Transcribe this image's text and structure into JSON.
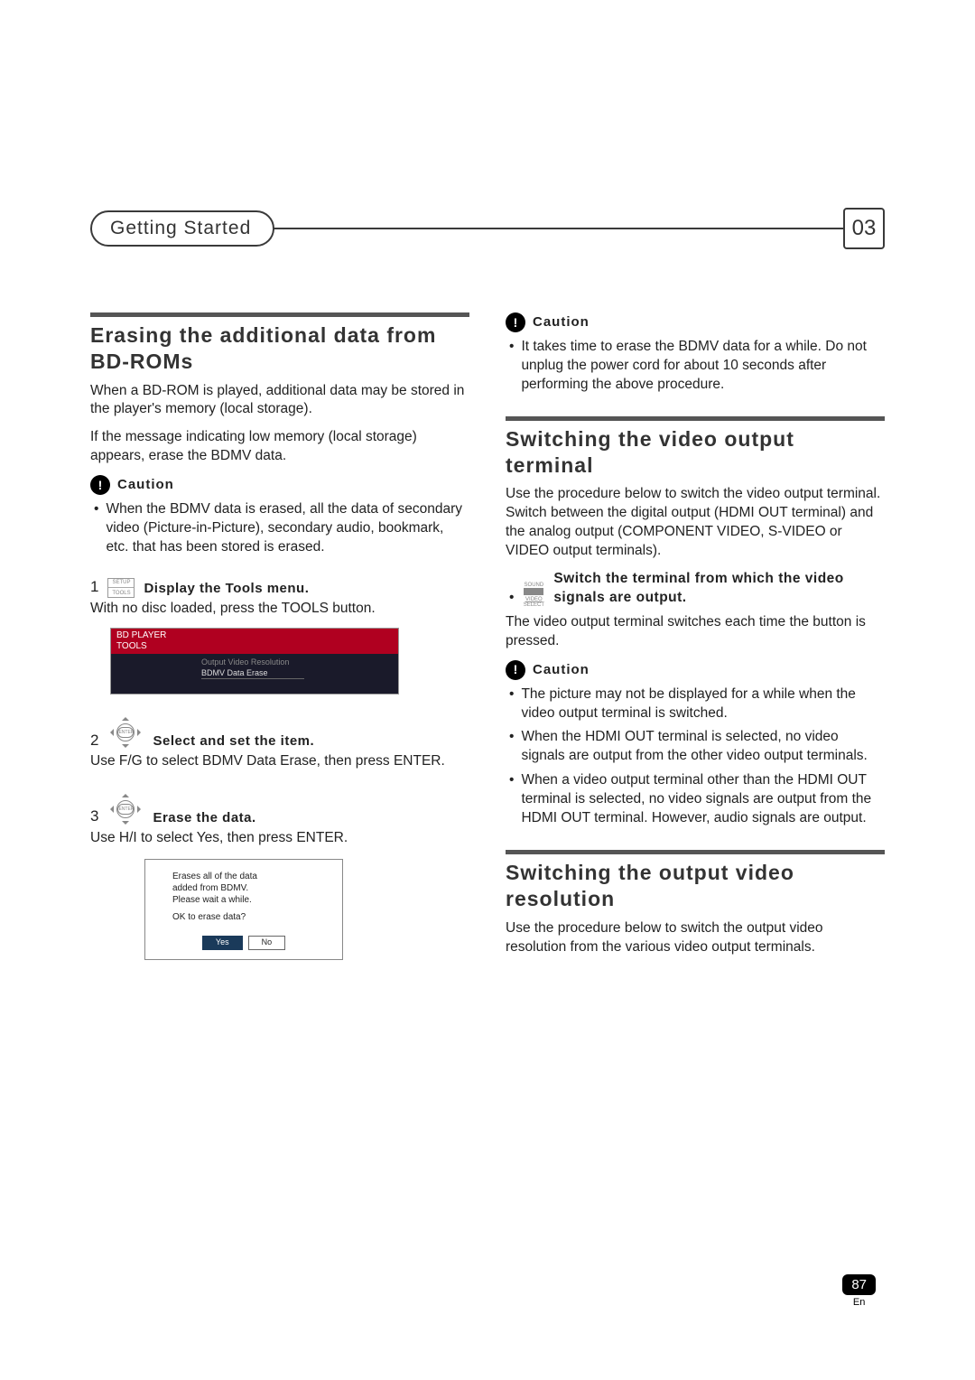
{
  "header": {
    "section_name": "Getting Started",
    "chapter": "03"
  },
  "left": {
    "title": "Erasing the additional data from BD-ROMs",
    "p1": "When a BD-ROM is played, additional data may be stored in the player's memory (local storage).",
    "p2": "If the message indicating low memory (local storage) appears, erase the BDMV data.",
    "caution_label": "Caution",
    "caution_b1": "When the BDMV data is erased, all the data of secondary video (Picture-in-Picture), secondary audio, bookmark, etc. that has been stored is erased.",
    "step1_num": "1",
    "step1_icon_top": "SETUP",
    "step1_icon_bottom": "TOOLS",
    "step1_title": "Display the Tools menu.",
    "step1_body": "With no disc loaded, press the TOOLS button.",
    "menu": {
      "line1": "BD PLAYER",
      "line2": "TOOLS",
      "item1": "Output Video Resolution",
      "item2": "BDMV Data Erase"
    },
    "step2_num": "2",
    "step2_title": "Select and set the item.",
    "step2_body": "Use F/G to select BDMV Data Erase, then press ENTER.",
    "step3_num": "3",
    "step3_title": "Erase the data.",
    "step3_body": "Use H/I to select Yes, then press ENTER.",
    "dialog": {
      "l1": "Erases all of the data",
      "l2": "added from BDMV.",
      "l3": "Please wait a while.",
      "q": "OK to erase data?",
      "yes": "Yes",
      "no": "No"
    }
  },
  "right": {
    "caution_label": "Caution",
    "top_b1": "It takes time to erase the BDMV data for a while. Do not unplug the power cord for about 10 seconds after performing the above procedure.",
    "sec2_title": "Switching the video output terminal",
    "sec2_p1": "Use the procedure below to switch the video output terminal. Switch between the digital output (HDMI OUT terminal) and the analog output (COMPONENT VIDEO, S-VIDEO or VIDEO output terminals).",
    "select_icon_top": "SOUND",
    "select_icon_mid": "VIDEO",
    "select_icon_bot": "SELECT",
    "sec2_b1": "Switch the terminal from which the video signals are output.",
    "sec2_p2": "The video output terminal switches each time the button is pressed.",
    "sec2_c1": "The picture may not be displayed for a while when the video output terminal is switched.",
    "sec2_c2": "When the HDMI OUT terminal is selected, no video signals are output from the other video output terminals.",
    "sec2_c3": "When a video output terminal other than the HDMI OUT terminal is selected, no video signals are output from the HDMI OUT terminal. However, audio signals are output.",
    "sec3_title": "Switching the output video resolution",
    "sec3_p1": "Use the procedure below to switch the output video resolution from the various video output terminals."
  },
  "page": {
    "number": "87",
    "lang": "En"
  }
}
